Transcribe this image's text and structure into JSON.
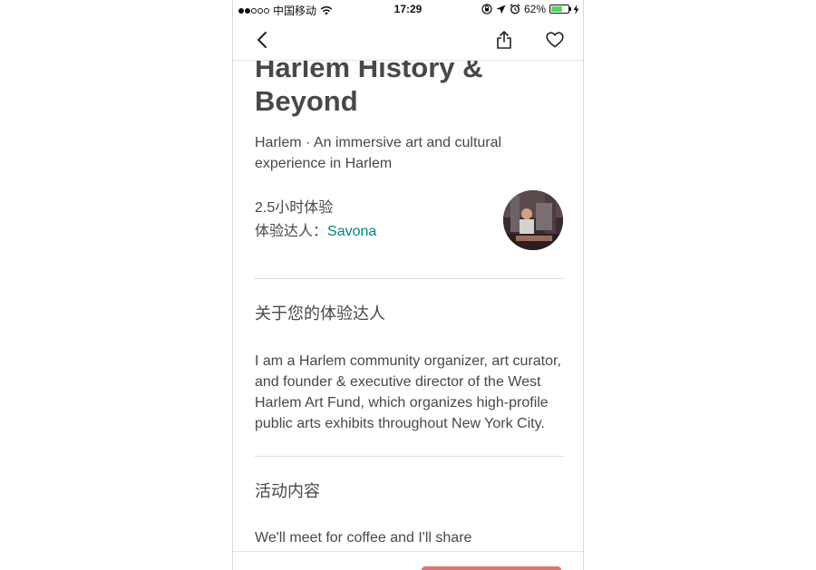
{
  "status_bar": {
    "carrier": "中国移动",
    "time": "17:29",
    "battery_percent": "62%",
    "battery_level": 0.62,
    "icons": [
      "signal-icon",
      "wifi-icon",
      "orientation-lock-icon",
      "location-arrow-icon",
      "alarm-icon",
      "battery-icon",
      "charging-icon"
    ]
  },
  "nav": {
    "back_icon": "chevron-left-icon",
    "share_icon": "share-icon",
    "favorite_icon": "heart-icon"
  },
  "experience": {
    "title": "Harlem History & Beyond",
    "subtitle": "Harlem · An immersive art and cultural experience in Harlem",
    "duration": "2.5小时体验",
    "host_label": "体验达人：",
    "host_name": "Savona"
  },
  "about_host": {
    "heading": "关于您的体验达人",
    "body": "I am a Harlem community organizer, art curator, and founder & executive director of the West Harlem Art Fund, which organizes high-profile public arts exhibits throughout New York City."
  },
  "activity": {
    "heading": "活动内容",
    "body": "We'll meet for coffee and I'll share"
  },
  "colors": {
    "text": "#484848",
    "link": "#008489",
    "accent": "#f16d6d",
    "battery": "#4cd964"
  }
}
